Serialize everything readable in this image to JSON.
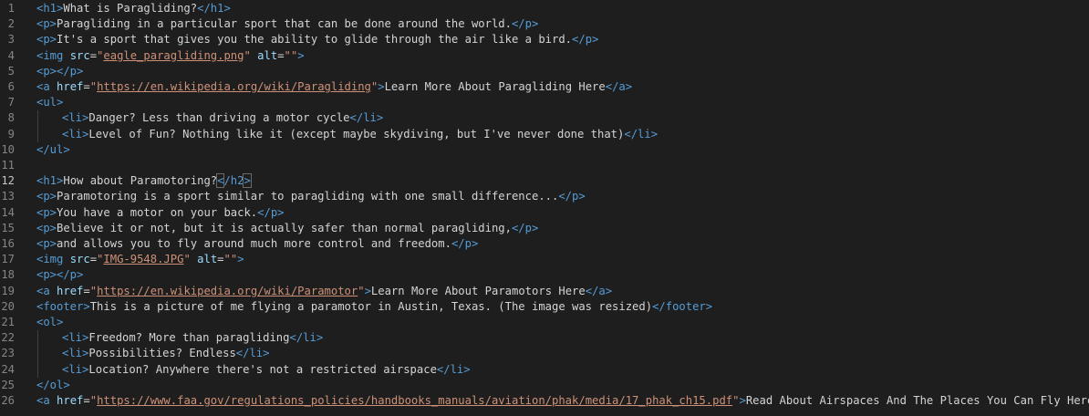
{
  "editor": {
    "active_line": 12,
    "lines": [
      {
        "n": "1",
        "indent": 0,
        "tokens": [
          [
            "tag",
            "<h1>"
          ],
          [
            "txt",
            "What is Paragliding?"
          ],
          [
            "tag",
            "</h1>"
          ]
        ]
      },
      {
        "n": "2",
        "indent": 0,
        "tokens": [
          [
            "tag",
            "<p>"
          ],
          [
            "txt",
            "Paragliding in a particular sport that can be done around the world."
          ],
          [
            "tag",
            "</p>"
          ]
        ]
      },
      {
        "n": "3",
        "indent": 0,
        "tokens": [
          [
            "tag",
            "<p>"
          ],
          [
            "txt",
            "It's a sport that gives you the ability to glide through the air like a bird."
          ],
          [
            "tag",
            "</p>"
          ]
        ]
      },
      {
        "n": "4",
        "indent": 0,
        "tokens": [
          [
            "tag",
            "<img "
          ],
          [
            "attr",
            "src"
          ],
          [
            "txt",
            "="
          ],
          [
            "str",
            "\""
          ],
          [
            "link",
            "eagle_paragliding.png"
          ],
          [
            "str",
            "\""
          ],
          [
            "txt",
            " "
          ],
          [
            "attr",
            "alt"
          ],
          [
            "txt",
            "="
          ],
          [
            "str",
            "\"\""
          ],
          [
            "tag",
            ">"
          ]
        ]
      },
      {
        "n": "5",
        "indent": 0,
        "tokens": [
          [
            "tag",
            "<p></p>"
          ]
        ]
      },
      {
        "n": "6",
        "indent": 0,
        "tokens": [
          [
            "tag",
            "<a "
          ],
          [
            "attr",
            "href"
          ],
          [
            "txt",
            "="
          ],
          [
            "str",
            "\""
          ],
          [
            "link",
            "https://en.wikipedia.org/wiki/Paragliding"
          ],
          [
            "str",
            "\""
          ],
          [
            "tag",
            ">"
          ],
          [
            "txt",
            "Learn More About Paragliding Here"
          ],
          [
            "tag",
            "</a>"
          ]
        ]
      },
      {
        "n": "7",
        "indent": 0,
        "tokens": [
          [
            "tag",
            "<ul>"
          ]
        ]
      },
      {
        "n": "8",
        "indent": 1,
        "tokens": [
          [
            "tag",
            "<li>"
          ],
          [
            "txt",
            "Danger? Less than driving a motor cycle"
          ],
          [
            "tag",
            "</li>"
          ]
        ]
      },
      {
        "n": "9",
        "indent": 1,
        "tokens": [
          [
            "tag",
            "<li>"
          ],
          [
            "txt",
            "Level of Fun? Nothing like it (except maybe skydiving, but I've never done that)"
          ],
          [
            "tag",
            "</li>"
          ]
        ]
      },
      {
        "n": "10",
        "indent": 0,
        "tokens": [
          [
            "tag",
            "</ul>"
          ]
        ]
      },
      {
        "n": "11",
        "indent": 0,
        "tokens": []
      },
      {
        "n": "12",
        "indent": 0,
        "tokens": [
          [
            "tag",
            "<h1>"
          ],
          [
            "txt",
            "How about Paramotoring?"
          ],
          [
            "tagbox",
            "<"
          ],
          [
            "tag",
            "/h2"
          ],
          [
            "tagbox",
            ">"
          ]
        ]
      },
      {
        "n": "13",
        "indent": 0,
        "tokens": [
          [
            "tag",
            "<p>"
          ],
          [
            "txt",
            "Paramotoring is a sport similar to paragliding with one small difference..."
          ],
          [
            "tag",
            "</p>"
          ]
        ]
      },
      {
        "n": "14",
        "indent": 0,
        "tokens": [
          [
            "tag",
            "<p>"
          ],
          [
            "txt",
            "You have a motor on your back."
          ],
          [
            "tag",
            "</p>"
          ]
        ]
      },
      {
        "n": "15",
        "indent": 0,
        "tokens": [
          [
            "tag",
            "<p>"
          ],
          [
            "txt",
            "Believe it or not, but it is actually safer than normal paragliding,"
          ],
          [
            "tag",
            "</p>"
          ]
        ]
      },
      {
        "n": "16",
        "indent": 0,
        "tokens": [
          [
            "tag",
            "<p>"
          ],
          [
            "txt",
            "and allows you to fly around much more control and freedom."
          ],
          [
            "tag",
            "</p>"
          ]
        ]
      },
      {
        "n": "17",
        "indent": 0,
        "tokens": [
          [
            "tag",
            "<img "
          ],
          [
            "attr",
            "src"
          ],
          [
            "txt",
            "="
          ],
          [
            "str",
            "\""
          ],
          [
            "link",
            "IMG-9548.JPG"
          ],
          [
            "str",
            "\""
          ],
          [
            "txt",
            " "
          ],
          [
            "attr",
            "alt"
          ],
          [
            "txt",
            "="
          ],
          [
            "str",
            "\"\""
          ],
          [
            "tag",
            ">"
          ]
        ]
      },
      {
        "n": "18",
        "indent": 0,
        "tokens": [
          [
            "tag",
            "<p></p>"
          ]
        ]
      },
      {
        "n": "19",
        "indent": 0,
        "tokens": [
          [
            "tag",
            "<a "
          ],
          [
            "attr",
            "href"
          ],
          [
            "txt",
            "="
          ],
          [
            "str",
            "\""
          ],
          [
            "link",
            "https://en.wikipedia.org/wiki/Paramotor"
          ],
          [
            "str",
            "\""
          ],
          [
            "tag",
            ">"
          ],
          [
            "txt",
            "Learn More About Paramotors Here"
          ],
          [
            "tag",
            "</a>"
          ]
        ]
      },
      {
        "n": "20",
        "indent": 0,
        "tokens": [
          [
            "tag",
            "<footer>"
          ],
          [
            "txt",
            "This is a picture of me flying a paramotor in Austin, Texas. (The image was resized)"
          ],
          [
            "tag",
            "</footer>"
          ]
        ]
      },
      {
        "n": "21",
        "indent": 0,
        "tokens": [
          [
            "tag",
            "<ol>"
          ]
        ]
      },
      {
        "n": "22",
        "indent": 1,
        "tokens": [
          [
            "tag",
            "<li>"
          ],
          [
            "txt",
            "Freedom? More than paragliding"
          ],
          [
            "tag",
            "</li>"
          ]
        ]
      },
      {
        "n": "23",
        "indent": 1,
        "tokens": [
          [
            "tag",
            "<li>"
          ],
          [
            "txt",
            "Possibilities? Endless"
          ],
          [
            "tag",
            "</li>"
          ]
        ]
      },
      {
        "n": "24",
        "indent": 1,
        "tokens": [
          [
            "tag",
            "<li>"
          ],
          [
            "txt",
            "Location? Anywhere there's not a restricted airspace"
          ],
          [
            "tag",
            "</li>"
          ]
        ]
      },
      {
        "n": "25",
        "indent": 0,
        "tokens": [
          [
            "tag",
            "</ol>"
          ]
        ]
      },
      {
        "n": "26",
        "indent": 0,
        "tokens": [
          [
            "tag",
            "<a "
          ],
          [
            "attr",
            "href"
          ],
          [
            "txt",
            "="
          ],
          [
            "str",
            "\""
          ],
          [
            "link",
            "https://www.faa.gov/regulations_policies/handbooks_manuals/aviation/phak/media/17_phak_ch15.pdf"
          ],
          [
            "str",
            "\""
          ],
          [
            "tag",
            ">"
          ],
          [
            "txt",
            "Read About Airspaces And The Places You Can Fly Here"
          ],
          [
            "tag",
            "</a>"
          ]
        ]
      }
    ]
  }
}
